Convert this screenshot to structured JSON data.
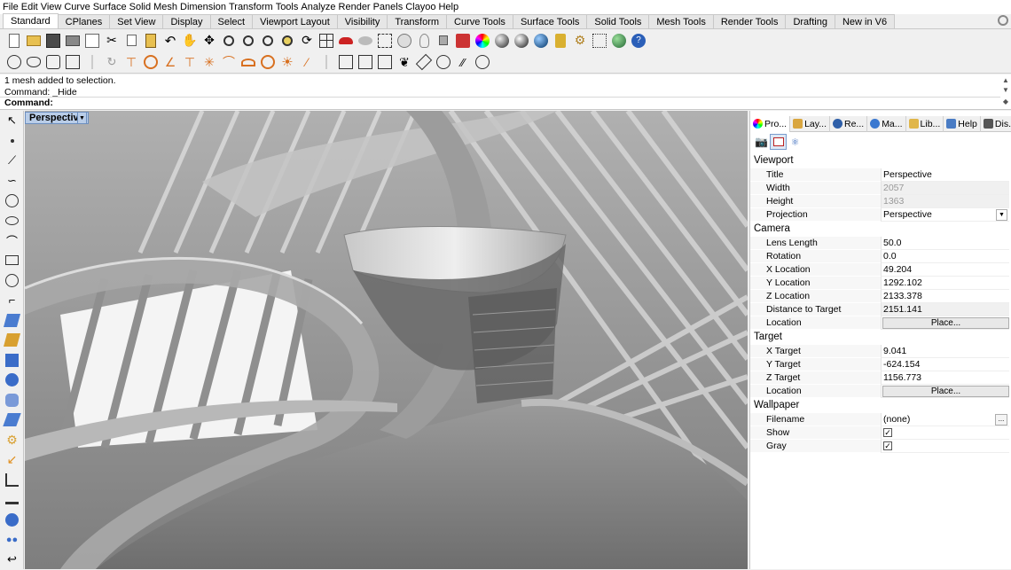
{
  "menu": [
    "File",
    "Edit",
    "View",
    "Curve",
    "Surface",
    "Solid",
    "Mesh",
    "Dimension",
    "Transform",
    "Tools",
    "Analyze",
    "Render",
    "Panels",
    "Clayoo",
    "Help"
  ],
  "tabs": [
    "Standard",
    "CPlanes",
    "Set View",
    "Display",
    "Select",
    "Viewport Layout",
    "Visibility",
    "Transform",
    "Curve Tools",
    "Surface Tools",
    "Solid Tools",
    "Mesh Tools",
    "Render Tools",
    "Drafting",
    "New in V6"
  ],
  "command": {
    "history": [
      "1 mesh added to selection.",
      "Command: _Hide"
    ],
    "prompt": "Command:",
    "value": ""
  },
  "viewport": {
    "label": "Perspective"
  },
  "panel": {
    "tabs": [
      {
        "label": "Pro...",
        "icon": "properties-icon",
        "color": "#3b6fd6"
      },
      {
        "label": "Lay...",
        "icon": "layers-icon",
        "color": "#d9a640"
      },
      {
        "label": "Re...",
        "icon": "render-icon",
        "color": "#2f5fa8"
      },
      {
        "label": "Ma...",
        "icon": "materials-icon",
        "color": "#3a78d0"
      },
      {
        "label": "Lib...",
        "icon": "libraries-icon",
        "color": "#e0b64a"
      },
      {
        "label": "Help",
        "icon": "help-icon",
        "color": "#4a7cc4"
      },
      {
        "label": "Dis...",
        "icon": "display-icon",
        "color": "#555555"
      }
    ],
    "sections": {
      "viewport": {
        "title": "Viewport",
        "title_label": "Title",
        "title_value": "Perspective",
        "width_label": "Width",
        "width_value": "2057",
        "height_label": "Height",
        "height_value": "1363",
        "projection_label": "Projection",
        "projection_value": "Perspective"
      },
      "camera": {
        "title": "Camera",
        "lens_label": "Lens Length",
        "lens_value": "50.0",
        "rotation_label": "Rotation",
        "rotation_value": "0.0",
        "x_label": "X Location",
        "x_value": "49.204",
        "y_label": "Y Location",
        "y_value": "1292.102",
        "z_label": "Z Location",
        "z_value": "2133.378",
        "dist_label": "Distance to Target",
        "dist_value": "2151.141",
        "location_label": "Location",
        "place_label": "Place..."
      },
      "target": {
        "title": "Target",
        "x_label": "X Target",
        "x_value": "9.041",
        "y_label": "Y Target",
        "y_value": "-624.154",
        "z_label": "Z Target",
        "z_value": "1156.773",
        "location_label": "Location",
        "place_label": "Place..."
      },
      "wallpaper": {
        "title": "Wallpaper",
        "filename_label": "Filename",
        "filename_value": "(none)",
        "browse_label": "...",
        "show_label": "Show",
        "show_checked": true,
        "gray_label": "Gray",
        "gray_checked": true
      }
    }
  },
  "colors": {
    "accent": "#b9cde8",
    "panel_bg": "#ffffff",
    "toolbar_bg": "#f0f0f0"
  }
}
